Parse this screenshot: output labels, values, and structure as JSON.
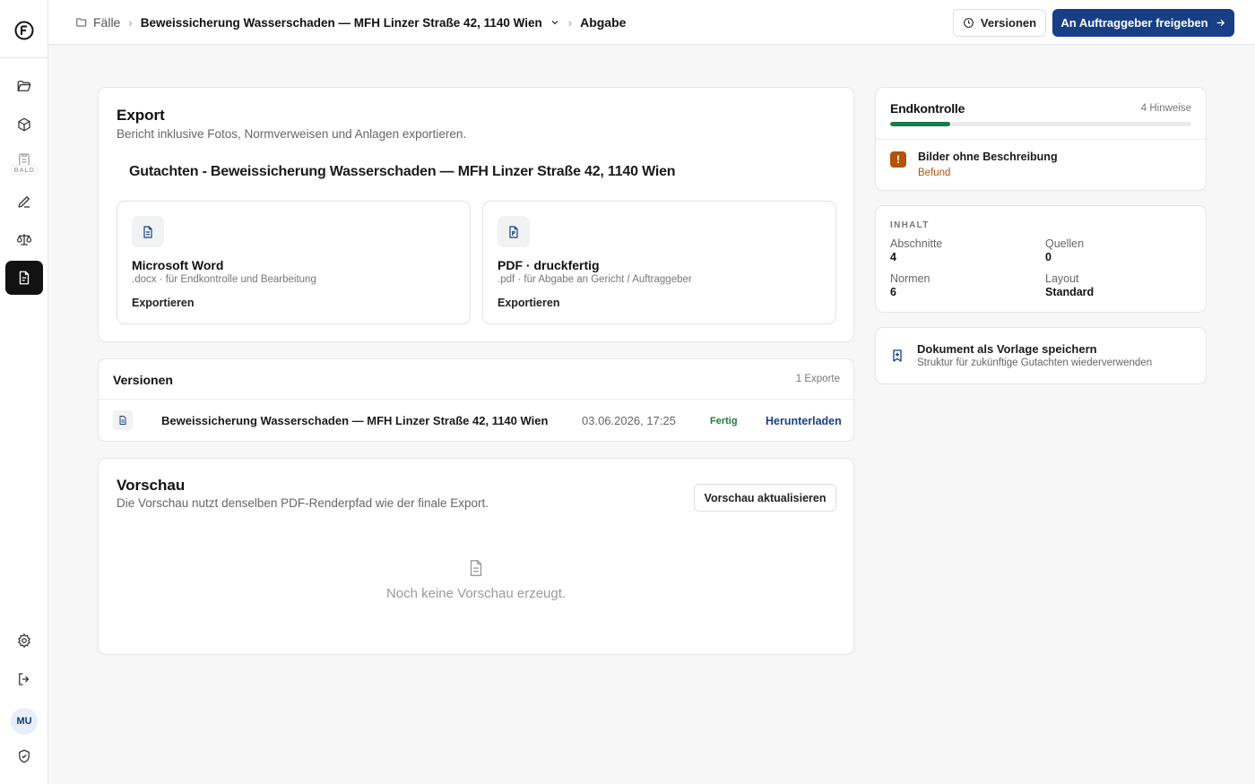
{
  "breadcrumb": {
    "home_label": "Fälle",
    "case_label": "Beweissicherung Wasserschaden — MFH Linzer Straße 42, 1140 Wien",
    "current_label": "Abgabe"
  },
  "header": {
    "versions_button": "Versionen",
    "release_button": "An Auftraggeber freigeben"
  },
  "sidebar": {
    "soon_badge": "BALD",
    "avatar_initials": "MU"
  },
  "export": {
    "title": "Export",
    "subtitle": "Bericht inklusive Fotos, Normverweisen und Anlagen exportieren.",
    "document_title": "Gutachten - Beweissicherung Wasserschaden — MFH Linzer Straße 42, 1140 Wien",
    "options": [
      {
        "name": "Microsoft Word",
        "description": ".docx · für Endkontrolle und Bearbeitung",
        "action": "Exportieren"
      },
      {
        "name": "PDF · druckfertig",
        "description": ".pdf · für Abgabe an Gericht / Auftraggeber",
        "action": "Exportieren"
      }
    ]
  },
  "versions": {
    "title": "Versionen",
    "count": "1 Exporte",
    "rows": [
      {
        "name": "Beweissicherung Wasserschaden — MFH Linzer Straße 42, 1140 Wien",
        "date": "03.06.2026, 17:25",
        "status": "Fertig",
        "action": "Herunterladen"
      }
    ]
  },
  "preview": {
    "title": "Vorschau",
    "subtitle": "Die Vorschau nutzt denselben PDF-Renderpfad wie der finale Export.",
    "refresh_button": "Vorschau aktualisieren",
    "empty_text": "Noch keine Vorschau erzeugt."
  },
  "final_check": {
    "title": "Endkontrolle",
    "count": "4 Hinweise",
    "progress_fraction": 0.2,
    "progress_color": "#1b7a4b",
    "issues": [
      {
        "icon": "!",
        "title": "Bilder ohne Beschreibung",
        "section": "Befund"
      }
    ]
  },
  "content": {
    "label": "INHALT",
    "stats": [
      {
        "key": "Abschnitte",
        "value": "4"
      },
      {
        "key": "Quellen",
        "value": "0"
      },
      {
        "key": "Normen",
        "value": "6"
      },
      {
        "key": "Layout",
        "value": "Standard"
      }
    ]
  },
  "template": {
    "title": "Dokument als Vorlage speichern",
    "subtitle": "Struktur für zukünftige Gutachten wiederverwenden"
  },
  "colors": {
    "accent": "#173f86",
    "success": "#1f7a3d",
    "warning": "#b45309"
  }
}
